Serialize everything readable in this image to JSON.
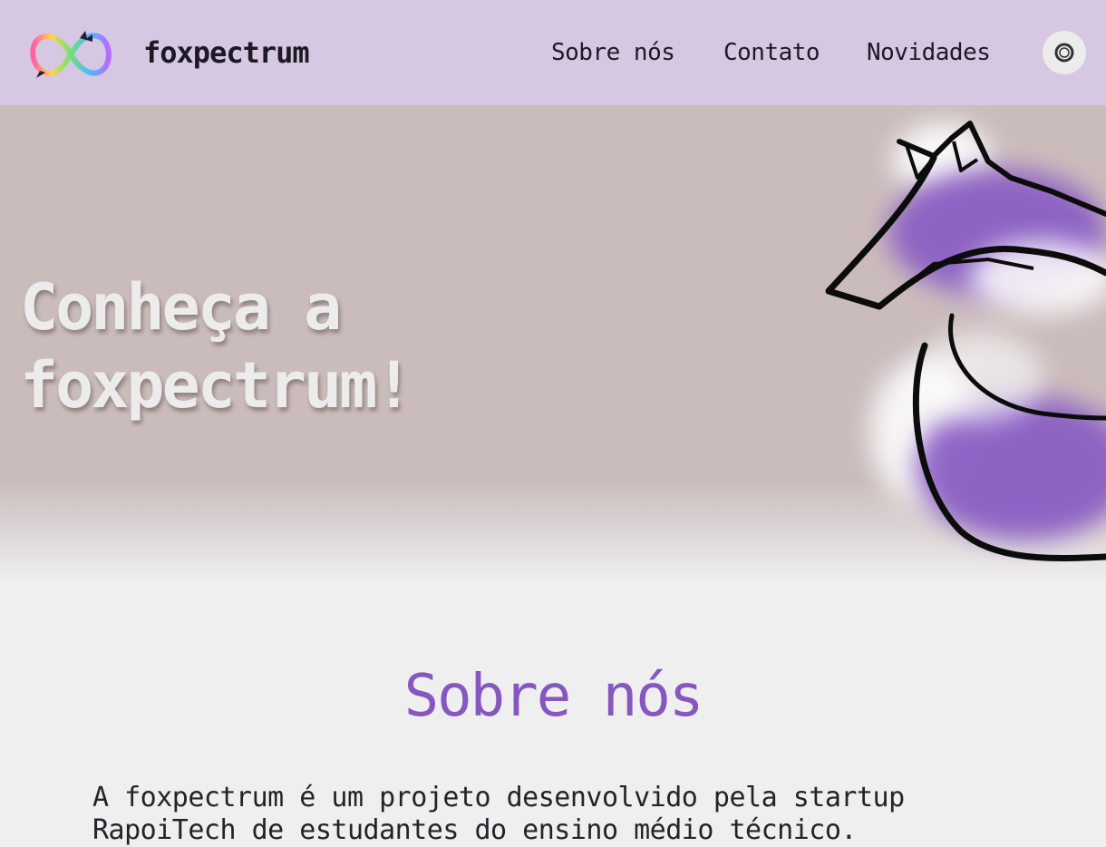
{
  "header": {
    "brand": "foxpectrum",
    "nav": {
      "about": "Sobre nós",
      "contact": "Contato",
      "news": "Novidades"
    },
    "theme_toggle_icon": "ring-icon"
  },
  "hero": {
    "title_line1": "Conheça a",
    "title_line2": "foxpectrum!"
  },
  "about": {
    "title": "Sobre nós",
    "text": "A foxpectrum é um projeto desenvolvido pela startup RapoiTech de estudantes do ensino médio técnico."
  },
  "colors": {
    "header_bg": "#d6c7e2",
    "hero_bg": "#cbbcbc",
    "page_bg": "#efefef",
    "accent_purple": "#8657bf"
  }
}
